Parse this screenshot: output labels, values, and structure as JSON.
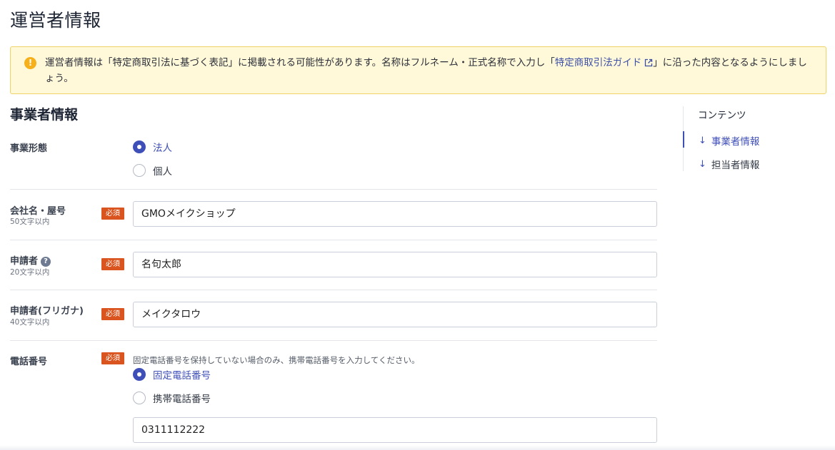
{
  "page": {
    "title": "運営者情報"
  },
  "notice": {
    "icon": "info-icon",
    "text_before": "運営者情報は「特定商取引法に基づく表記」に掲載される可能性があります。名称はフルネーム・正式名称で入力し「",
    "link_label": "特定商取引法ガイド",
    "text_after": "」に沿った内容となるようにしましょう。",
    "colors": {
      "background": "#fff8d9",
      "border": "#f0d266",
      "icon": "#f5b01a",
      "link": "#3b4fa8"
    }
  },
  "section": {
    "title": "事業者情報"
  },
  "form": {
    "business_type": {
      "label": "事業形態",
      "options": [
        {
          "label": "法人",
          "selected": true
        },
        {
          "label": "個人",
          "selected": false
        }
      ]
    },
    "company_name": {
      "label": "会社名・屋号",
      "sublabel": "50文字以内",
      "required_label": "必須",
      "value": "GMOメイクショップ"
    },
    "applicant": {
      "label": "申請者",
      "help_icon": "question-icon",
      "sublabel": "20文字以内",
      "required_label": "必須",
      "value": "名句太郎"
    },
    "applicant_kana": {
      "label": "申請者(フリガナ)",
      "sublabel": "40文字以内",
      "required_label": "必須",
      "value": "メイクタロウ"
    },
    "phone": {
      "label": "電話番号",
      "required_label": "必須",
      "hint": "固定電話番号を保持していない場合のみ、携帯電話番号を入力してください。",
      "options": [
        {
          "label": "固定電話番号",
          "selected": true
        },
        {
          "label": "携帯電話番号",
          "selected": false
        }
      ],
      "value": "0311112222"
    }
  },
  "toc": {
    "title": "コンテンツ",
    "items": [
      {
        "label": "事業者情報",
        "active": true,
        "icon": "arrow-down-icon"
      },
      {
        "label": "担当者情報",
        "active": false,
        "icon": "arrow-down-icon"
      }
    ]
  },
  "colors": {
    "accent": "#3f4fb8",
    "required_badge": "#d9541e"
  }
}
